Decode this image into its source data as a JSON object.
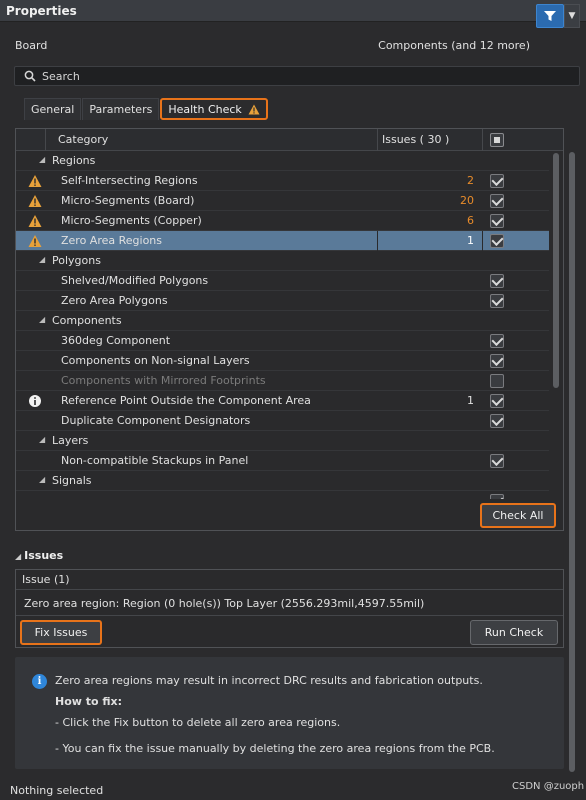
{
  "window": {
    "title": "Properties"
  },
  "board": {
    "label": "Board",
    "components_label": "Components (and 12 more)"
  },
  "search": {
    "placeholder": "Search"
  },
  "tabs": [
    {
      "label": "General"
    },
    {
      "label": "Parameters"
    },
    {
      "label": "Health Check"
    }
  ],
  "table": {
    "col_category": "Category",
    "col_issues": "Issues ( 30 )",
    "rows": [
      {
        "type": "group",
        "label": "Regions"
      },
      {
        "type": "item",
        "label": "Self-Intersecting Regions",
        "icon": "warning",
        "count": "2",
        "checked": true
      },
      {
        "type": "item",
        "label": "Micro-Segments (Board)",
        "icon": "warning",
        "count": "20",
        "checked": true
      },
      {
        "type": "item",
        "label": "Micro-Segments (Copper)",
        "icon": "warning",
        "count": "6",
        "checked": true
      },
      {
        "type": "item",
        "label": "Zero Area Regions",
        "icon": "warning",
        "count": "1",
        "checked": true,
        "selected": true
      },
      {
        "type": "group",
        "label": "Polygons"
      },
      {
        "type": "item",
        "label": "Shelved/Modified Polygons",
        "checked": true
      },
      {
        "type": "item",
        "label": "Zero Area Polygons",
        "checked": true
      },
      {
        "type": "group",
        "label": "Components"
      },
      {
        "type": "item",
        "label": "360deg Component",
        "checked": true
      },
      {
        "type": "item",
        "label": "Components on Non-signal Layers",
        "checked": true
      },
      {
        "type": "item",
        "label": "Components with Mirrored Footprints",
        "checked": false,
        "dim": true
      },
      {
        "type": "item",
        "label": "Reference Point Outside the Component Area",
        "icon": "info",
        "count": "1",
        "count_white": true,
        "checked": true
      },
      {
        "type": "item",
        "label": "Duplicate Component Designators",
        "checked": true
      },
      {
        "type": "group",
        "label": "Layers"
      },
      {
        "type": "item",
        "label": "Non-compatible Stackups in Panel",
        "checked": true
      },
      {
        "type": "group",
        "label": "Signals"
      },
      {
        "type": "item",
        "label": "",
        "checked": true
      }
    ]
  },
  "check_all_label": "Check All",
  "issues": {
    "heading": "Issues",
    "header": "Issue (1)",
    "row": "Zero area region: Region (0 hole(s)) Top Layer (2556.293mil,4597.55mil)"
  },
  "fix_issues_label": "Fix Issues",
  "run_check_label": "Run Check",
  "info": {
    "line1": "Zero area regions may result in incorrect DRC results and fabrication outputs.",
    "how_to": "How to fix:",
    "line2": "- Click the Fix button to delete all zero area regions.",
    "line3": "- You can fix the issue manually by deleting the zero area regions from the PCB."
  },
  "status": "Nothing selected",
  "watermark": "CSDN @zuoph",
  "colors": {
    "accent": "#e8731a",
    "warning": "#e8a13a",
    "selected_row": "#5a7a99",
    "filter_button": "#2b6bb0"
  }
}
